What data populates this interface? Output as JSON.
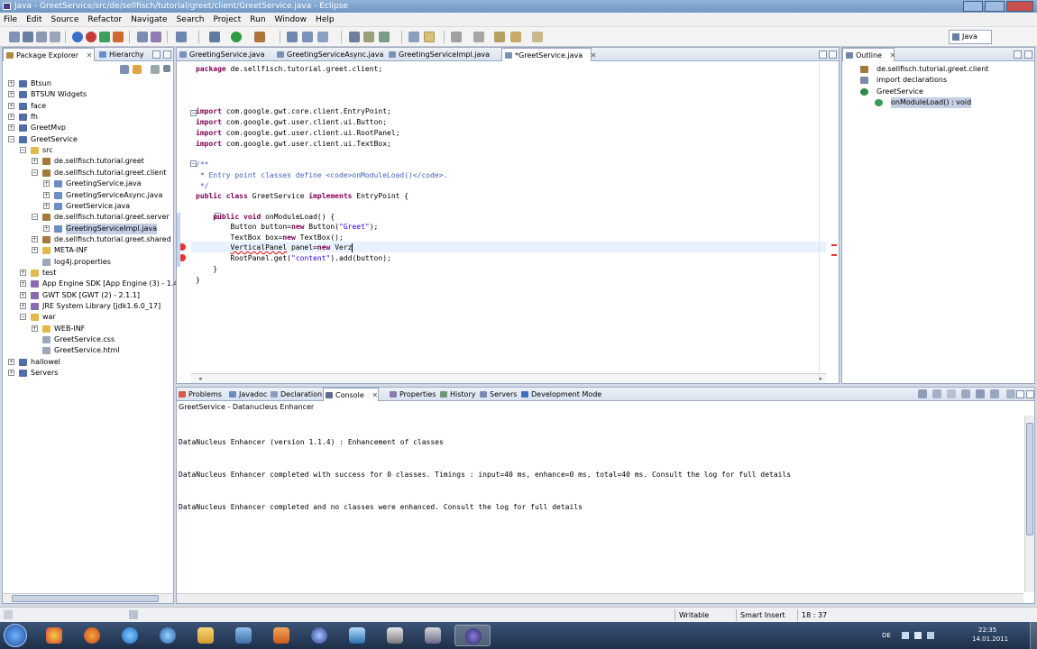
{
  "window": {
    "title": "Java - GreetService/src/de/sellfisch/tutorial/greet/client/GreetService.java - Eclipse"
  },
  "menu": [
    "File",
    "Edit",
    "Source",
    "Refactor",
    "Navigate",
    "Search",
    "Project",
    "Run",
    "Window",
    "Help"
  ],
  "perspective": {
    "label": "Java"
  },
  "package_explorer": {
    "tabs": [
      {
        "label": "Package Explorer",
        "close": "✕"
      },
      {
        "label": "Hierarchy"
      }
    ],
    "tree": [
      {
        "label": "Btsun",
        "indent": 0,
        "expander": "+",
        "icon": "project"
      },
      {
        "label": "BTSUN Widgets",
        "indent": 0,
        "expander": "+",
        "icon": "project"
      },
      {
        "label": "face",
        "indent": 0,
        "expander": "+",
        "icon": "project"
      },
      {
        "label": "fh",
        "indent": 0,
        "expander": "+",
        "icon": "project"
      },
      {
        "label": "GreetMvp",
        "indent": 0,
        "expander": "+",
        "icon": "project"
      },
      {
        "label": "GreetService",
        "indent": 0,
        "expander": "-",
        "icon": "project"
      },
      {
        "label": "src",
        "indent": 1,
        "expander": "-",
        "icon": "folder"
      },
      {
        "label": "de.sellfisch.tutorial.greet",
        "indent": 2,
        "expander": "+",
        "icon": "package"
      },
      {
        "label": "de.sellfisch.tutorial.greet.client",
        "indent": 2,
        "expander": "-",
        "icon": "package"
      },
      {
        "label": "GreetingService.java",
        "indent": 3,
        "expander": "+",
        "icon": "java"
      },
      {
        "label": "GreetingServiceAsync.java",
        "indent": 3,
        "expander": "+",
        "icon": "java"
      },
      {
        "label": "GreetService.java",
        "indent": 3,
        "expander": "+",
        "icon": "java"
      },
      {
        "label": "de.sellfisch.tutorial.greet.server",
        "indent": 2,
        "expander": "-",
        "icon": "package"
      },
      {
        "label": "GreetingServiceImpl.java",
        "indent": 3,
        "expander": "+",
        "icon": "java",
        "selected": true
      },
      {
        "label": "de.sellfisch.tutorial.greet.shared",
        "indent": 2,
        "expander": "+",
        "icon": "package"
      },
      {
        "label": "META-INF",
        "indent": 2,
        "expander": "+",
        "icon": "folder"
      },
      {
        "label": "log4j.properties",
        "indent": 2,
        "expander": "",
        "icon": "file"
      },
      {
        "label": "test",
        "indent": 1,
        "expander": "+",
        "icon": "folder"
      },
      {
        "label": "App Engine SDK [App Engine (3) - 1.4.0]",
        "indent": 1,
        "expander": "+",
        "icon": "lib"
      },
      {
        "label": "GWT SDK [GWT (2) - 2.1.1]",
        "indent": 1,
        "expander": "+",
        "icon": "lib"
      },
      {
        "label": "JRE System Library [jdk1.6.0_17]",
        "indent": 1,
        "expander": "+",
        "icon": "lib"
      },
      {
        "label": "war",
        "indent": 1,
        "expander": "-",
        "icon": "folder"
      },
      {
        "label": "WEB-INF",
        "indent": 2,
        "expander": "+",
        "icon": "folder"
      },
      {
        "label": "GreetService.css",
        "indent": 2,
        "expander": "",
        "icon": "file"
      },
      {
        "label": "GreetService.html",
        "indent": 2,
        "expander": "",
        "icon": "file"
      },
      {
        "label": "hallowel",
        "indent": 0,
        "expander": "+",
        "icon": "project"
      },
      {
        "label": "Servers",
        "indent": 0,
        "expander": "+",
        "icon": "project"
      }
    ]
  },
  "editor": {
    "tabs": [
      {
        "label": "GreetingService.java"
      },
      {
        "label": "GreetingServiceAsync.java"
      },
      {
        "label": "GreetingServiceImpl.java"
      },
      {
        "label": "*GreetService.java",
        "active": true,
        "close": "✕"
      }
    ],
    "lines": {
      "l1": "package de.sellfisch.tutorial.greet.client;",
      "l5": "import com.google.gwt.core.client.EntryPoint;",
      "l6": "import com.google.gwt.user.client.ui.Button;",
      "l7": "import com.google.gwt.user.client.ui.RootPanel;",
      "l8": "import com.google.gwt.user.client.ui.TextBox;",
      "l10": "/**",
      "l11": " * Entry point classes define <code>onModuleLoad()</code>.",
      "l12": " */",
      "l13": "public class GreetService implements EntryPoint {",
      "l15": "    public void onModuleLoad() {",
      "l16": "        Button button=new Button(\"Greet\");",
      "l17": "        TextBox box=new TextBox();",
      "l18a": "        ",
      "l18b": "VerticalPanel",
      "l18c": " panel=new Verz",
      "l19": "        RootPanel.get(\"content\").add(button);",
      "l20": "    }",
      "l21": "}"
    }
  },
  "outline": {
    "tab": "Outline",
    "close": "✕",
    "items": [
      {
        "label": "de.sellfisch.tutorial.greet.client",
        "indent": 0
      },
      {
        "label": "import declarations",
        "indent": 0
      },
      {
        "label": "GreetService",
        "indent": 0
      },
      {
        "label": "onModuleLoad() : void",
        "indent": 1,
        "selected": true
      }
    ]
  },
  "bottom": {
    "tabs": [
      {
        "label": "Problems"
      },
      {
        "label": "Javadoc"
      },
      {
        "label": "Declaration"
      },
      {
        "label": "Console",
        "active": true,
        "close": "✕"
      },
      {
        "label": "Properties"
      },
      {
        "label": "History"
      },
      {
        "label": "Servers"
      },
      {
        "label": "Development Mode"
      }
    ],
    "console_title": "GreetService - Datanucleus Enhancer",
    "console_lines": [
      "DataNucleus Enhancer (version 1.1.4) : Enhancement of classes",
      "DataNucleus Enhancer completed with success for 0 classes. Timings : input=40 ms, enhance=0 ms, total=40 ms. Consult the log for full details",
      "DataNucleus Enhancer completed and no classes were enhanced. Consult the log for full details"
    ]
  },
  "status": {
    "writable": "Writable",
    "insert_mode": "Smart Insert",
    "position": "18 : 37"
  },
  "tray": {
    "language": "DE",
    "time": "22:35",
    "date": "14.01.2011"
  },
  "colors": {
    "keyword": "#7f0055",
    "string": "#2a00ff",
    "comment": "#3f5fbf",
    "error": "#ee3333",
    "selection": "#c4cfe4"
  },
  "icons": {
    "project": "#4f6ea8",
    "folder": "#e2b94a",
    "package": "#a37a3c",
    "java": "#6b8ec4",
    "file": "#9aa8b8",
    "lib": "#8a6bb0"
  }
}
